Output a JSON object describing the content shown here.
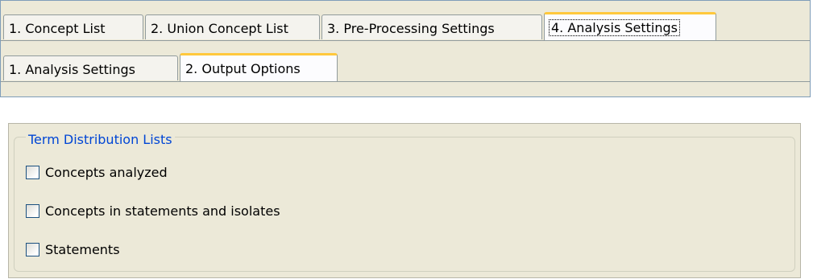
{
  "tabs_primary": [
    {
      "label": "1. Concept List"
    },
    {
      "label": "2. Union Concept List"
    },
    {
      "label": "3. Pre-Processing Settings"
    },
    {
      "label": "4. Analysis Settings"
    }
  ],
  "tabs_secondary": [
    {
      "label": "1. Analysis Settings"
    },
    {
      "label": "2. Output Options"
    }
  ],
  "group": {
    "title": "Term Distribution Lists",
    "options": [
      {
        "label": "Concepts analyzed",
        "checked": false
      },
      {
        "label": "Concepts in statements and isolates",
        "checked": false
      },
      {
        "label": "Statements",
        "checked": false
      }
    ]
  },
  "colors": {
    "window_bg": "#ece9d8",
    "active_tab_accent": "#ffc83c",
    "groupbox_title": "#0046d5",
    "checkbox_border": "#1c5180"
  }
}
